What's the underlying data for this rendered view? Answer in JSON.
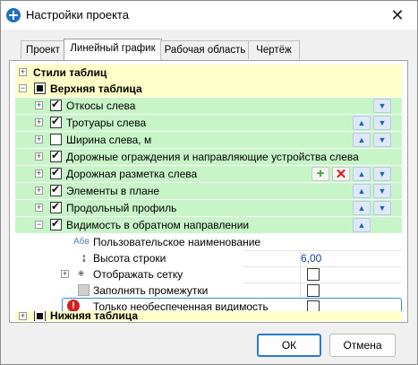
{
  "window": {
    "title": "Настройки проекта",
    "close_icon": "close-icon"
  },
  "tabs": [
    {
      "label": "Проект",
      "active": false
    },
    {
      "label": "Линейный график",
      "active": true
    },
    {
      "label": "Рабочая область",
      "active": false
    },
    {
      "label": "Чертёж",
      "active": false
    }
  ],
  "tree": {
    "table_styles": "Стили таблиц",
    "top_table": "Верхняя таблица",
    "items": [
      {
        "label": "Откосы слева",
        "checked": true
      },
      {
        "label": "Тротуары слева",
        "checked": true
      },
      {
        "label": "Ширина слева, м",
        "checked": false
      },
      {
        "label": "Дорожные ограждения и направляющие устройства слева",
        "checked": true
      },
      {
        "label": "Дорожная разметка слева",
        "checked": true
      },
      {
        "label": "Элементы в плане",
        "checked": true
      },
      {
        "label": "Продольный профиль",
        "checked": true
      },
      {
        "label": "Видимость в обратном направлении",
        "checked": true
      }
    ],
    "props": {
      "custom_name": "Пользовательское наименование",
      "custom_name_icon": "Абв",
      "row_height": "Высота строки",
      "row_height_value": "6,00",
      "show_grid": "Отображать сетку",
      "fill_gaps": "Заполнять промежутки",
      "only_unsecured": "Только необеспеченная видимость"
    },
    "bottom_table": "Нижняя таблица"
  },
  "buttons": {
    "ok": "ОК",
    "cancel": "Отмена"
  },
  "colors": {
    "row_green": "#c8f5c8",
    "row_yellow": "#fefec8",
    "focus_border": "#2f8fd8",
    "value_text": "#1a3fa8"
  }
}
